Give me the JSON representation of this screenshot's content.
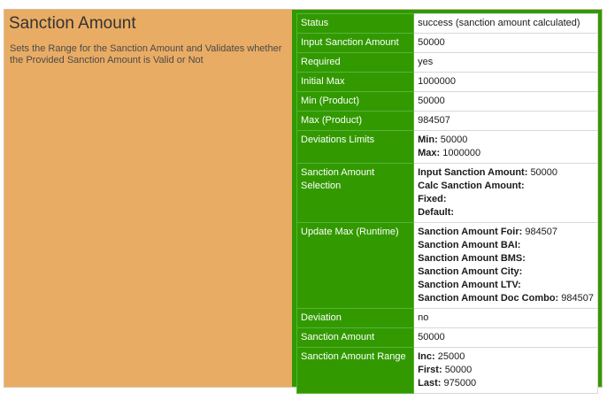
{
  "header": {
    "title": "Sanction Amount",
    "description": "Sets the Range for the Sanction Amount and Validates whether the Provided Sanction Amount is Valid or Not"
  },
  "colors": {
    "panel_bg": "#e9ac64",
    "key_bg": "#329a00",
    "border_green": "#319a00"
  },
  "rows": [
    {
      "key": "Status",
      "value": "success (sanction amount calculated)"
    },
    {
      "key": "Input Sanction Amount",
      "value": "50000"
    },
    {
      "key": "Required",
      "value": "yes"
    },
    {
      "key": "Initial Max",
      "value": "1000000"
    },
    {
      "key": "Min (Product)",
      "value": "50000"
    },
    {
      "key": "Max (Product)",
      "value": "984507"
    },
    {
      "key": "Deviations Limits",
      "lines": [
        {
          "label": "Min:",
          "value": "50000"
        },
        {
          "label": "Max:",
          "value": "1000000"
        }
      ]
    },
    {
      "key": "Sanction Amount Selection",
      "lines": [
        {
          "label": "Input Sanction Amount:",
          "value": "50000"
        },
        {
          "label": "Calc Sanction Amount:",
          "value": ""
        },
        {
          "label": "Fixed:",
          "value": ""
        },
        {
          "label": "Default:",
          "value": ""
        }
      ]
    },
    {
      "key": "Update Max (Runtime)",
      "lines": [
        {
          "label": "Sanction Amount Foir:",
          "value": "984507"
        },
        {
          "label": "Sanction Amount BAI:",
          "value": ""
        },
        {
          "label": "Sanction Amount BMS:",
          "value": ""
        },
        {
          "label": "Sanction Amount City:",
          "value": ""
        },
        {
          "label": "Sanction Amount LTV:",
          "value": ""
        },
        {
          "label": "Sanction Amount Doc Combo:",
          "value": "984507"
        }
      ]
    },
    {
      "key": "Deviation",
      "value": "no"
    },
    {
      "key": "Sanction Amount",
      "value": "50000"
    },
    {
      "key": "Sanction Amount Range",
      "lines": [
        {
          "label": "Inc:",
          "value": "25000"
        },
        {
          "label": "First:",
          "value": "50000"
        },
        {
          "label": "Last:",
          "value": "975000"
        }
      ]
    }
  ]
}
